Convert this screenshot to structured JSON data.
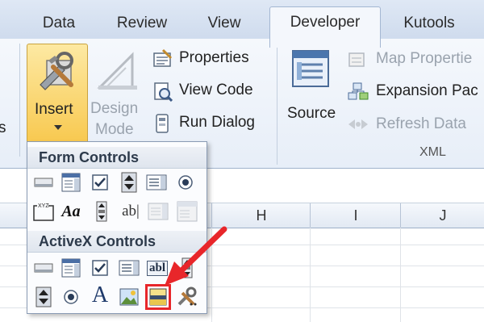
{
  "tabs": [
    "Data",
    "Review",
    "View",
    "Developer",
    "Kutools"
  ],
  "active_tab": "Developer",
  "ribbon": {
    "insert_label": "Insert",
    "design_mode_line1": "Design",
    "design_mode_line2": "Mode",
    "properties_label": "Properties",
    "view_code_label": "View Code",
    "run_dialog_label": "Run Dialog",
    "source_label": "Source",
    "map_properties_label": "Map Propertie",
    "expansion_packs_label": "Expansion Pac",
    "refresh_data_label": "Refresh Data",
    "xml_group_label": "XML",
    "left_cut_label": "s"
  },
  "grid": {
    "columns": [
      "H",
      "I",
      "J"
    ]
  },
  "dropdown": {
    "form_controls_title": "Form Controls",
    "activex_controls_title": "ActiveX Controls",
    "form_controls": [
      "button-icon",
      "combo-box-icon",
      "check-box-icon",
      "spin-button-icon",
      "list-box-icon",
      "option-button-icon",
      "group-box-icon",
      "label-icon",
      "scroll-bar-icon",
      "text-field-icon",
      "combo-list-edit-icon",
      "combo-drop-down-edit-icon"
    ],
    "activex_controls": [
      "command-button-icon",
      "combo-box-icon",
      "check-box-icon",
      "list-box-icon",
      "text-box-icon",
      "scroll-bar-icon",
      "spin-button-icon",
      "option-button-icon",
      "label-icon",
      "image-icon",
      "toggle-button-icon",
      "more-controls-icon"
    ],
    "highlighted_control": "toggle-button-icon",
    "label_glyph": "A",
    "text_field_glyph": "ab|",
    "text_box_glyph": "abl",
    "label_form_glyph": "Aa"
  },
  "colors": {
    "arrow": "#e8262a",
    "highlight_border": "#e8262a",
    "insert_highlight": "#fbd56a"
  }
}
